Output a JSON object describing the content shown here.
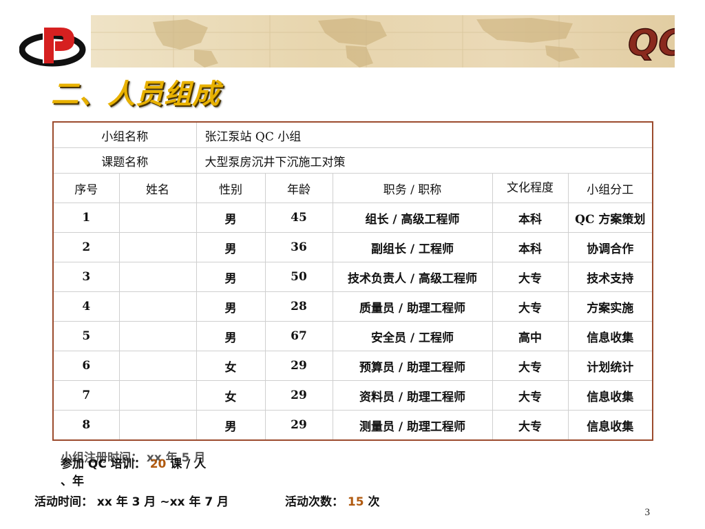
{
  "slide": {
    "title": "二、人员组成",
    "page_number": "3",
    "badge": "QC"
  },
  "table": {
    "group_name_label": "小组名称",
    "group_name_value": "张江泵站 QC 小组",
    "topic_label": "课题名称",
    "topic_value": "大型泵房沉井下沉施工对策",
    "headers": [
      "序号",
      "姓名",
      "性别",
      "年龄",
      "职务 / 职称",
      "文化程度",
      "小组分工"
    ],
    "rows": [
      {
        "no": "1",
        "name": "",
        "gender": "男",
        "age": "45",
        "title": "组长 / 高级工程师",
        "edu": "本科",
        "role": "QC 方案策划"
      },
      {
        "no": "2",
        "name": "",
        "gender": "男",
        "age": "36",
        "title": "副组长 / 工程师",
        "edu": "本科",
        "role": "协调合作"
      },
      {
        "no": "3",
        "name": "",
        "gender": "男",
        "age": "50",
        "title": "技术负责人 / 高级工程师",
        "edu": "大专",
        "role": "技术支持"
      },
      {
        "no": "4",
        "name": "",
        "gender": "男",
        "age": "28",
        "title": "质量员 / 助理工程师",
        "edu": "大专",
        "role": "方案实施"
      },
      {
        "no": "5",
        "name": "",
        "gender": "男",
        "age": "67",
        "title": "安全员 / 工程师",
        "edu": "高中",
        "role": "信息收集"
      },
      {
        "no": "6",
        "name": "",
        "gender": "女",
        "age": "29",
        "title": "预算员 / 助理工程师",
        "edu": "大专",
        "role": "计划统计"
      },
      {
        "no": "7",
        "name": "",
        "gender": "女",
        "age": "29",
        "title": "资料员 / 助理工程师",
        "edu": "大专",
        "role": "信息收集"
      },
      {
        "no": "8",
        "name": "",
        "gender": "男",
        "age": "29",
        "title": "测量员 / 助理工程师",
        "edu": "大专",
        "role": "信息收集"
      }
    ]
  },
  "notes": {
    "register_line": "小组注册时间： xx 年 5 月",
    "training_prefix": "参加 QC 培训：",
    "training_value": "20",
    "training_suffix": "课 / 人",
    "register_tail": "、年",
    "activity_time": "活动时间： xx 年 3 月 ~xx 年 7 月",
    "activity_count_prefix": "活动次数：",
    "activity_count_value": "15",
    "activity_count_suffix": "次"
  }
}
